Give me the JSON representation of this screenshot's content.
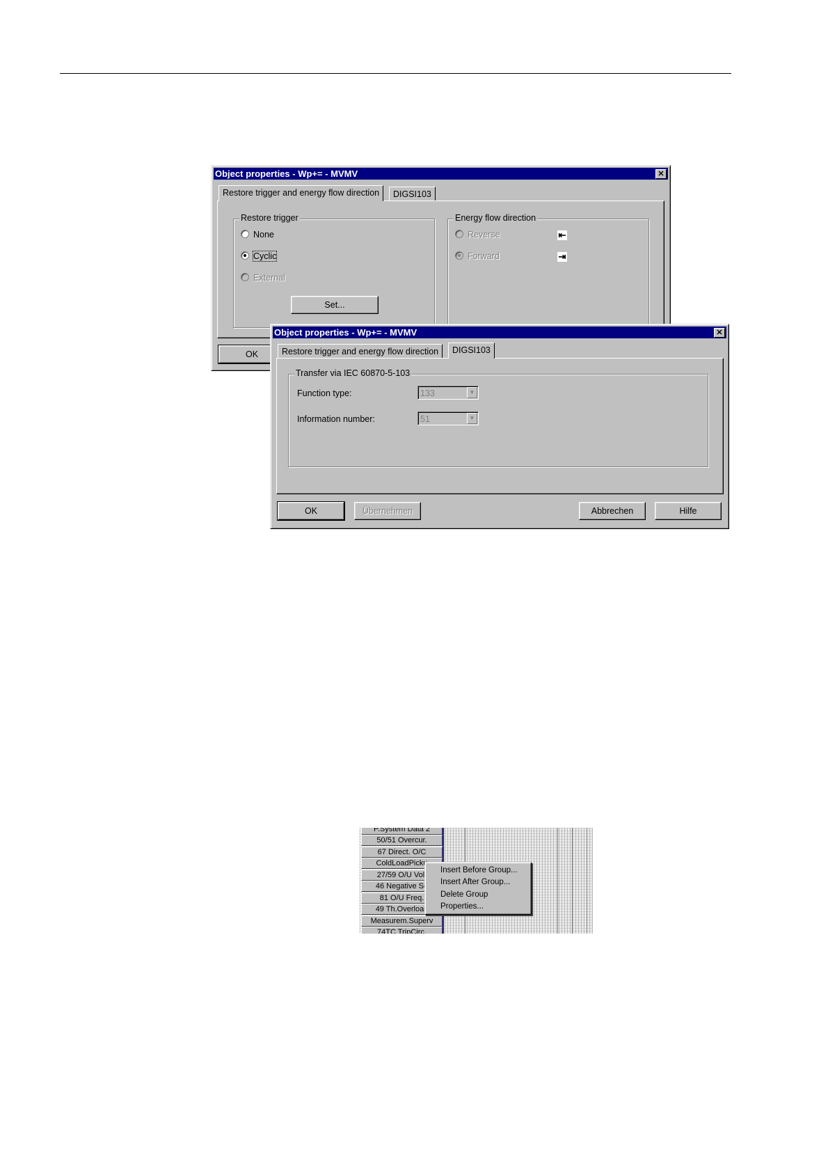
{
  "dialog1": {
    "title": "Object properties - Wp+= - MVMV",
    "close": "✕",
    "tab_restore": "Restore trigger and energy flow direction",
    "tab_digsi": "DIGSI103",
    "restore_group": "Restore trigger",
    "radio_none": "None",
    "radio_cyclic": "Cyclic",
    "radio_external": "External",
    "set_button": "Set...",
    "energy_group": "Energy flow direction",
    "radio_reverse": "Reverse",
    "radio_forward": "Forward",
    "reverse_arrow": "⇤",
    "forward_arrow": "⇥",
    "ok_button": "OK"
  },
  "dialog2": {
    "title": "Object properties - Wp+= - MVMV",
    "close": "✕",
    "tab_restore": "Restore trigger and energy flow direction",
    "tab_digsi": "DIGSI103",
    "group": "Transfer via IEC 60870-5-103",
    "function_type_label": "Function type:",
    "function_type_value": "133",
    "info_number_label": "Information number:",
    "info_number_value": "51",
    "ok_button": "OK",
    "apply_button": "Übernehmen",
    "cancel_button": "Abbrechen",
    "help_button": "Hilfe"
  },
  "grid": {
    "rows": [
      "P.System Data 2",
      "50/51 Overcur.",
      "67 Direct. O/C",
      "ColdLoadPicku",
      "27/59 O/U Volt",
      "46 Negative Se",
      "81 O/U Freq.",
      "49 Th.Overload",
      "Measurem.Superv",
      "74TC TripCirc."
    ]
  },
  "context_menu": {
    "insert_before": "Insert Before Group...",
    "insert_after": "Insert After Group...",
    "delete_group": "Delete Group",
    "properties": "Properties..."
  }
}
